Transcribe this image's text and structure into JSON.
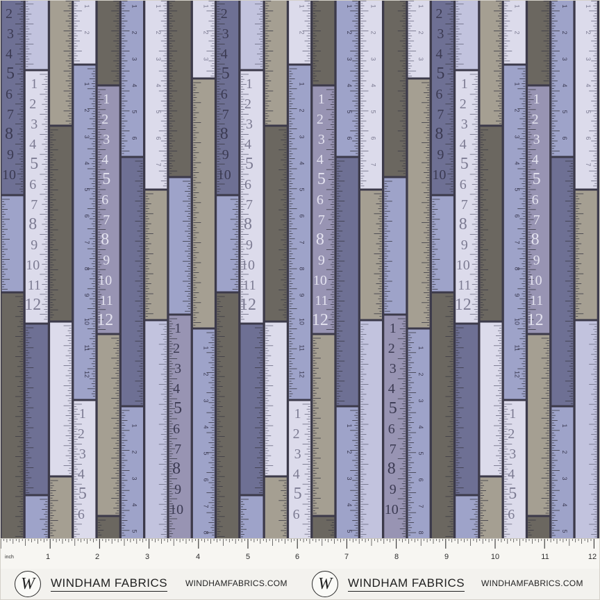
{
  "pattern": {
    "tape_numbers": [
      "1",
      "2",
      "3",
      "4",
      "5",
      "6",
      "7",
      "8",
      "9",
      "10",
      "11",
      "12"
    ],
    "palette": {
      "periwinkle": "#9ea3c9",
      "lavender": "#c2c3de",
      "pale_lilac": "#dcdbeb",
      "slate_blue": "#6e7094",
      "dusty_purple": "#9894b3",
      "taupe": "#a59f92",
      "dark_taupe": "#6b6760",
      "stone": "#8a857c",
      "seam": "#3c3a4a"
    }
  },
  "ruler": {
    "unit_label": "inch",
    "numbers": [
      "1",
      "2",
      "3",
      "4",
      "5",
      "6",
      "7",
      "8",
      "9",
      "10",
      "11",
      "12"
    ]
  },
  "footer": {
    "brand_left": {
      "logo_letter": "W",
      "name": "WINDHAM FABRICS"
    },
    "site_left": "WINDHAMFABRICS.COM",
    "brand_right": {
      "logo_letter": "W",
      "name": "WINDHAM FABRICS"
    },
    "site_right": "WINDHAMFABRICS.COM"
  }
}
